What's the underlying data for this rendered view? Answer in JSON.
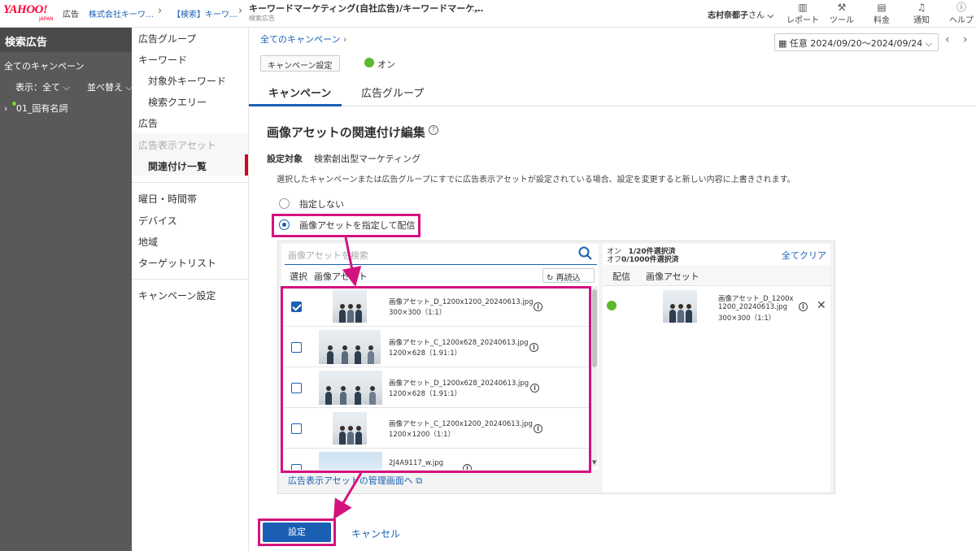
{
  "header": {
    "logo": "YAHOO!",
    "logo_sub": "JAPAN",
    "logo_ad": "広告",
    "breadcrumb": [
      "株式会社キーワ…",
      "【検索】キーワ…"
    ],
    "campaign_title": "キーワードマーケティング(自社広告)/キーワードマーケ…",
    "campaign_sub": "検索広告",
    "user_name": "志村奈都子",
    "user_suffix": "さん",
    "tools": [
      {
        "label": "レポート",
        "icon": "bar-chart-icon"
      },
      {
        "label": "ツール",
        "icon": "wrench-icon"
      },
      {
        "label": "料金",
        "icon": "wallet-icon"
      },
      {
        "label": "通知",
        "icon": "bell-icon"
      },
      {
        "label": "ヘルプ",
        "icon": "help-icon"
      }
    ]
  },
  "leftnav": {
    "title": "検索広告",
    "all_campaigns": "全てのキャンペーン",
    "display_filter": "表示：全て",
    "sort": "並べ替え",
    "campaign_item": "01_固有名詞"
  },
  "subnav": {
    "items": [
      "広告グループ",
      "キーワード",
      "対象外キーワード",
      "検索クエリー",
      "広告",
      "広告表示アセット",
      "関連付け一覧",
      "曜日・時間帯",
      "デバイス",
      "地域",
      "ターゲットリスト",
      "キャンペーン設定"
    ]
  },
  "main": {
    "breadcrumb": "全てのキャンペーン",
    "date_range": "任意 2024/09/20〜2024/09/24",
    "campaign_setting_btn": "キャンペーン設定",
    "status": "オン",
    "tabs": [
      "キャンペーン",
      "広告グループ"
    ],
    "section_title": "画像アセットの関連付け編集",
    "target_label": "設定対象",
    "target_value": "検索創出型マーケティング",
    "description": "選択したキャンペーンまたは広告グループにすでに広告表示アセットが設定されている場合、設定を変更すると新しい内容に上書きされます。",
    "radio_options": [
      "指定しない",
      "画像アセットを指定して配信"
    ],
    "search_placeholder": "画像アセットを検索",
    "col_select": "選択",
    "col_asset": "画像アセット",
    "reload": "再読込",
    "assets": [
      {
        "name": "画像アセット_D_1200x1200_20240613.jpg",
        "size": "300×300（1:1）",
        "checked": true
      },
      {
        "name": "画像アセット_C_1200x628_20240613.jpg",
        "size": "1200×628（1.91:1）",
        "checked": false
      },
      {
        "name": "画像アセット_D_1200x628_20240613.jpg",
        "size": "1200×628（1.91:1）",
        "checked": false
      },
      {
        "name": "画像アセット_C_1200x1200_20240613.jpg",
        "size": "1200×1200（1:1）",
        "checked": false
      },
      {
        "name": "2J4A9117_w.jpg",
        "size": "",
        "checked": false
      }
    ],
    "selected_on": "オン",
    "selected_on_count": "1/20件選択済",
    "selected_off": "オフ",
    "selected_off_count": "0/1000件選択済",
    "clear_all": "全てクリア",
    "col_delivery": "配信",
    "col_selected_asset": "画像アセット",
    "selected_asset_name_1": "画像アセット_D_1200x",
    "selected_asset_name_2": "1200_20240613.jpg",
    "selected_asset_size": "300×300（1:1）",
    "manage_link": "広告表示アセットの管理画面へ",
    "submit": "設定",
    "cancel": "キャンセル"
  }
}
